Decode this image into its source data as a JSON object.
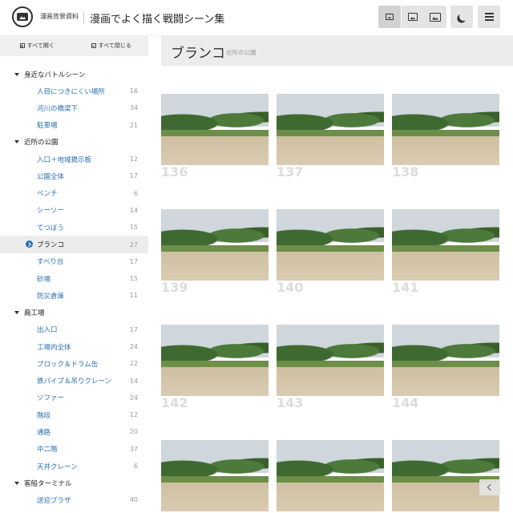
{
  "header": {
    "site_name": "漫画背景資料",
    "app_title": "漫画でよく描く戦闘シーン集",
    "buttons": [
      {
        "icon": "image-small-icon",
        "active": true
      },
      {
        "icon": "image-medium-icon",
        "active": false
      },
      {
        "icon": "image-large-icon",
        "active": false
      },
      {
        "icon": "moon-icon",
        "active": false
      },
      {
        "icon": "menu-icon",
        "active": false
      }
    ]
  },
  "sidebar": {
    "expand_all": "すべて開く",
    "collapse_all": "すべて閉じる",
    "categories": [
      {
        "label": "身近なバトルシーン",
        "items": [
          {
            "label": "人目につきにくい場所",
            "count": "16"
          },
          {
            "label": "河川の橋梁下",
            "count": "34"
          },
          {
            "label": "駐車場",
            "count": "21"
          }
        ]
      },
      {
        "label": "近所の公園",
        "items": [
          {
            "label": "入口＋地域掲示板",
            "count": "12"
          },
          {
            "label": "公園全体",
            "count": "17"
          },
          {
            "label": "ベンチ",
            "count": "6"
          },
          {
            "label": "シーソー",
            "count": "14"
          },
          {
            "label": "てつぼう",
            "count": "15"
          },
          {
            "label": "ブランコ",
            "count": "27",
            "active": true
          },
          {
            "label": "すべり台",
            "count": "17"
          },
          {
            "label": "砂場",
            "count": "15"
          },
          {
            "label": "防災倉庫",
            "count": "11"
          }
        ]
      },
      {
        "label": "廃工場",
        "items": [
          {
            "label": "出入口",
            "count": "17"
          },
          {
            "label": "工場内全体",
            "count": "24"
          },
          {
            "label": "ブロック＆ドラム缶",
            "count": "22"
          },
          {
            "label": "鉄パイプ＆吊りクレーン",
            "count": "14"
          },
          {
            "label": "ソファー",
            "count": "24"
          },
          {
            "label": "階段",
            "count": "12"
          },
          {
            "label": "通路",
            "count": "20"
          },
          {
            "label": "中二階",
            "count": "37"
          },
          {
            "label": "天井クレーン",
            "count": "6"
          }
        ]
      },
      {
        "label": "客船ターミナル",
        "items": [
          {
            "label": "送迎プラザ",
            "count": "40"
          }
        ]
      }
    ]
  },
  "page": {
    "title": "ブランコ",
    "subtitle": "近所の公園"
  },
  "gallery": [
    {
      "number": "136"
    },
    {
      "number": "137"
    },
    {
      "number": "138"
    },
    {
      "number": "139"
    },
    {
      "number": "140"
    },
    {
      "number": "141"
    },
    {
      "number": "142"
    },
    {
      "number": "143"
    },
    {
      "number": "144"
    },
    {
      "number": ""
    },
    {
      "number": ""
    },
    {
      "number": ""
    }
  ],
  "colors": {
    "link": "#2a6fb2",
    "header_bg": "#ececec"
  }
}
